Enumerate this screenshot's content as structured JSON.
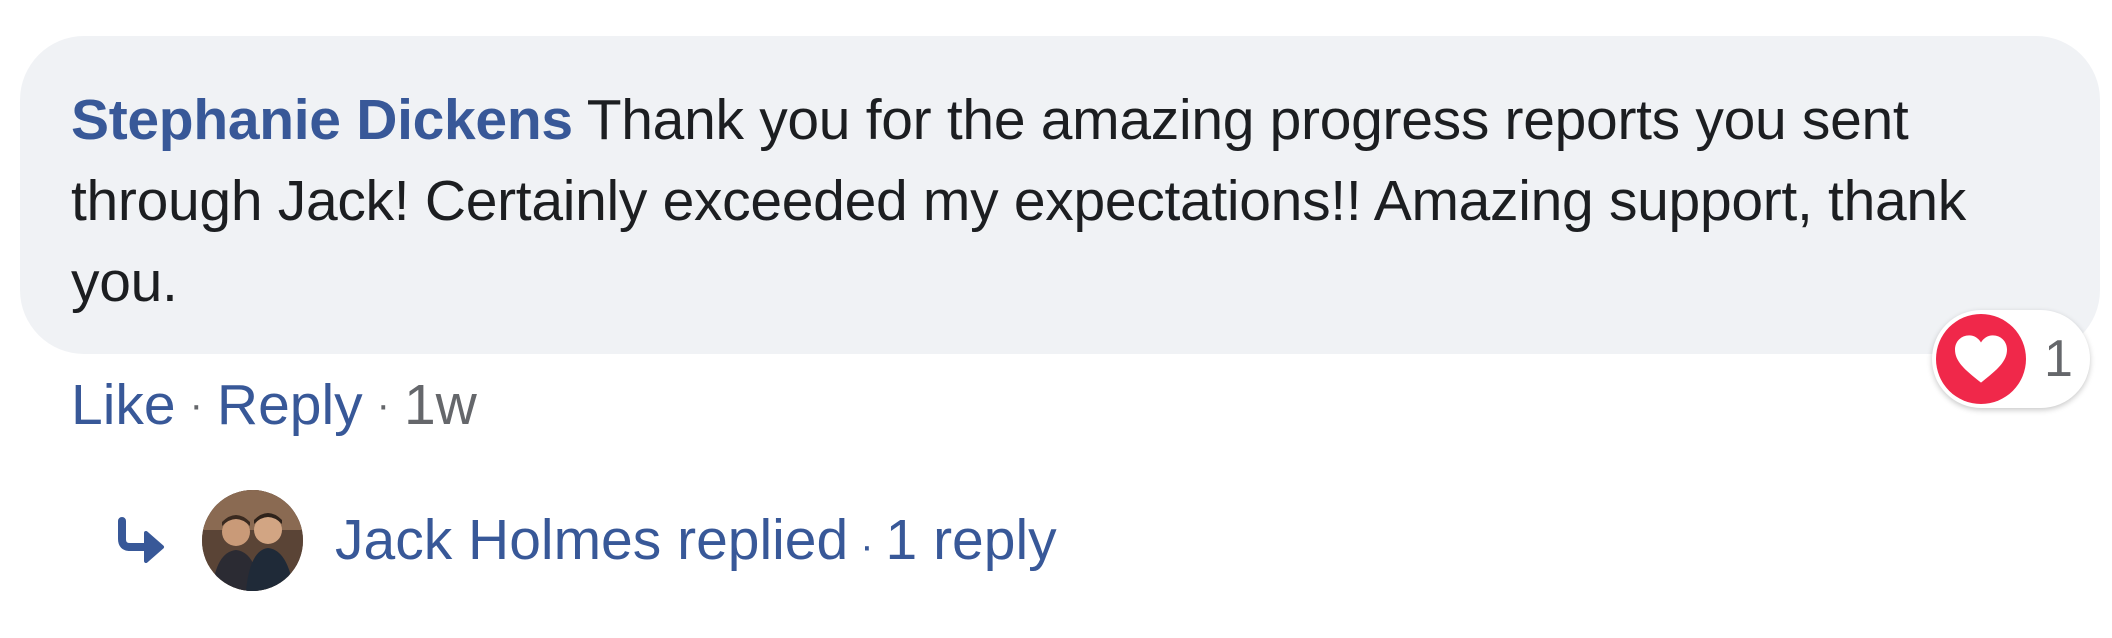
{
  "comment": {
    "author": "Stephanie Dickens",
    "text": "Thank you for the amazing progress reports you sent through Jack! Certainly exceeded my expectations!! Amazing support, thank you."
  },
  "reaction": {
    "icon": "heart-icon",
    "count": "1",
    "color": "#f0284a"
  },
  "actions": {
    "like_label": "Like",
    "reply_label": "Reply",
    "separator": "·",
    "timestamp": "1w"
  },
  "replies": {
    "icon": "reply-arrow-icon",
    "replier": "Jack Holmes replied",
    "separator": "·",
    "count_label": "1 reply"
  },
  "colors": {
    "link": "#385898",
    "text": "#1c1e21",
    "muted": "#65676b",
    "bubble": "#f0f2f5"
  }
}
